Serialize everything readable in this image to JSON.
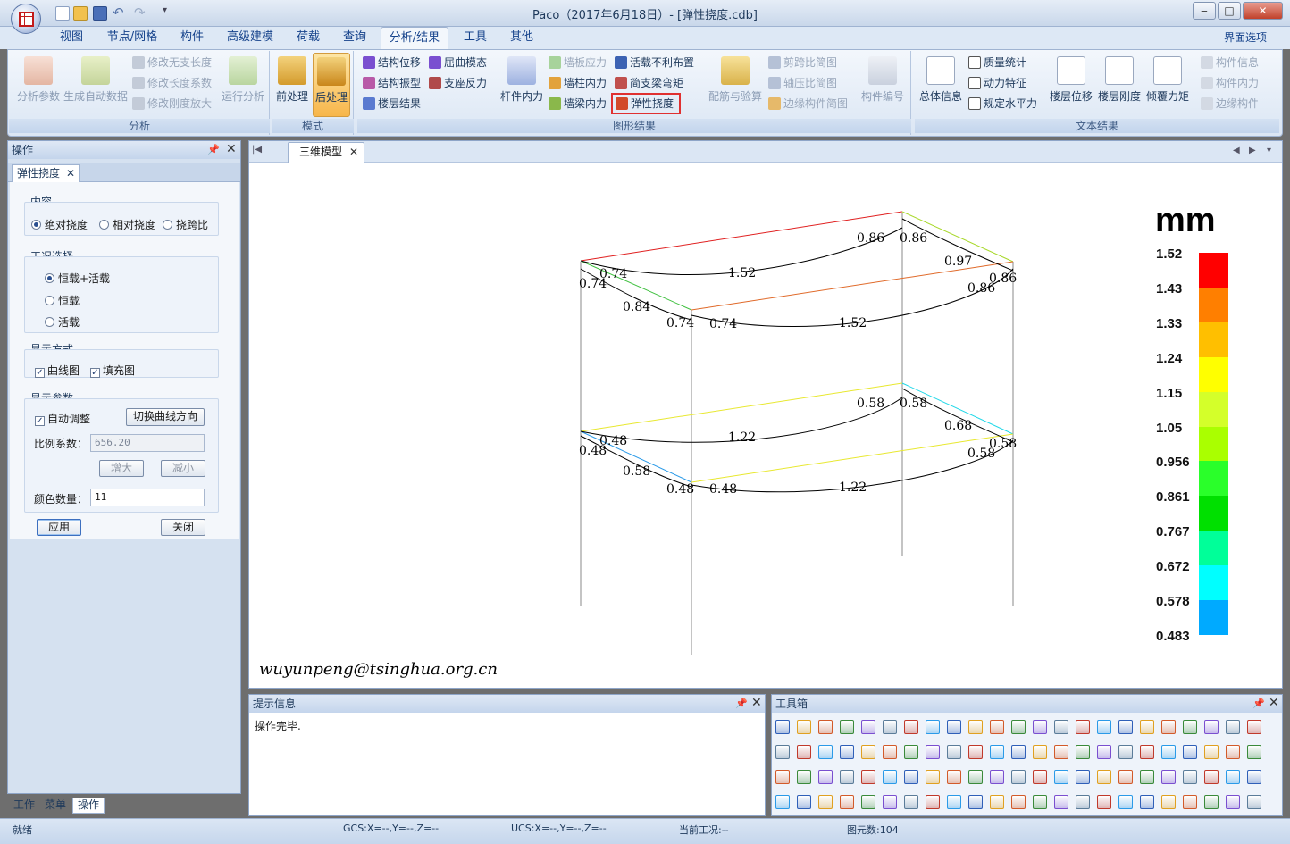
{
  "window": {
    "title": "Paco（2017年6月18日）- [弹性挠度.cdb]",
    "minimize": "‒",
    "maximize": "□",
    "close": "✕"
  },
  "quick_access": [
    "new-icon",
    "open-icon",
    "save-icon",
    "undo-icon",
    "redo-icon"
  ],
  "tabs": [
    "视图",
    "节点/网格",
    "构件",
    "高级建模",
    "荷载",
    "查询",
    "分析/结果",
    "工具",
    "其他"
  ],
  "active_tab": "分析/结果",
  "interface_options": "界面选项",
  "ribbon": {
    "analysis": {
      "label": "分析",
      "analysis_params": "分析参数",
      "gen_auto": "生成自动数据",
      "mod_unsupported": "修改无支长度",
      "mod_length_coef": "修改长度系数",
      "mod_stiffness": "修改刚度放大",
      "run": "运行分析"
    },
    "mode": {
      "label": "模式",
      "pre": "前处理",
      "post": "后处理"
    },
    "graphic": {
      "label": "图形结果",
      "struct_disp": "结构位移",
      "buckling": "屈曲模态",
      "struct_vib": "结构振型",
      "support_react": "支座反力",
      "floor_result": "楼层结果",
      "member_force": "杆件内力",
      "wall_stress": "墙板应力",
      "live_unfav": "活载不利布置",
      "wall_col_force": "墙柱内力",
      "simple_beam_moment": "简支梁弯矩",
      "wall_beam_force": "墙梁内力",
      "elastic_defl": "弹性挠度",
      "rebar_check": "配筋与验算",
      "shear_span": "剪跨比简图",
      "axial_ratio": "轴压比简图",
      "edge_member": "边缘构件简图",
      "member_no": "构件编号"
    },
    "text": {
      "label": "文本结果",
      "general": "总体信息",
      "mass": "质量统计",
      "dynamic": "动力特征",
      "level_disp": "楼层位移",
      "level_stiff": "楼层刚度",
      "overturn": "倾覆力矩",
      "code_h": "规定水平力",
      "member_info": "构件信息",
      "member_force": "构件内力",
      "edge_member": "边缘构件"
    }
  },
  "left_panel": {
    "title": "操作",
    "subtab": "弹性挠度",
    "content_legend": "内容",
    "content_options": [
      "绝对挠度",
      "相对挠度",
      "挠跨比"
    ],
    "case_legend": "工况选择",
    "case_options": [
      "恒载+活载",
      "恒载",
      "活载"
    ],
    "display_legend": "显示方式",
    "curve": "曲线图",
    "fill": "填充图",
    "params_legend": "显示参数",
    "auto_adjust": "自动调整",
    "switch_dir": "切换曲线方向",
    "scale_label": "比例系数：",
    "scale_value": "656.20",
    "increase": "增大",
    "decrease": "减小",
    "colors_label": "颜色数量：",
    "colors_value": "11",
    "apply": "应用",
    "close": "关闭",
    "bottom_tabs": [
      "工作",
      "菜单",
      "操作"
    ]
  },
  "viewport": {
    "tab": "三维模型",
    "watermark": "wuyunpeng@tsinghua.org.cn"
  },
  "legend": {
    "unit": "mm",
    "values": [
      "1.52",
      "1.43",
      "1.33",
      "1.24",
      "1.15",
      "1.05",
      "0.956",
      "0.861",
      "0.767",
      "0.672",
      "0.578",
      "0.483"
    ],
    "colors": [
      "#ff0000",
      "#ff7f00",
      "#ffbf00",
      "#ffff00",
      "#d4ff2a",
      "#aaff00",
      "#2aff2a",
      "#00e000",
      "#00ff99",
      "#00ffff",
      "#00aaff"
    ]
  },
  "labels": {
    "top": [
      "0.74",
      "0.74",
      "1.52",
      "0.86",
      "0.86",
      "0.97",
      "0.86",
      "0.86",
      "0.84",
      "0.74",
      "0.74",
      "1.52"
    ],
    "bottom": [
      "0.48",
      "0.48",
      "1.22",
      "0.58",
      "0.58",
      "0.68",
      "0.58",
      "0.58",
      "0.58",
      "0.48",
      "0.48",
      "1.22"
    ]
  },
  "message_panel": {
    "title": "提示信息",
    "text": "操作完毕."
  },
  "toolbox": {
    "title": "工具箱"
  },
  "status": {
    "ready": "就绪",
    "gcs": "GCS:X=--,Y=--,Z=--",
    "ucs": "UCS:X=--,Y=--,Z=--",
    "case": "当前工况:--",
    "elements": "图元数:104"
  }
}
